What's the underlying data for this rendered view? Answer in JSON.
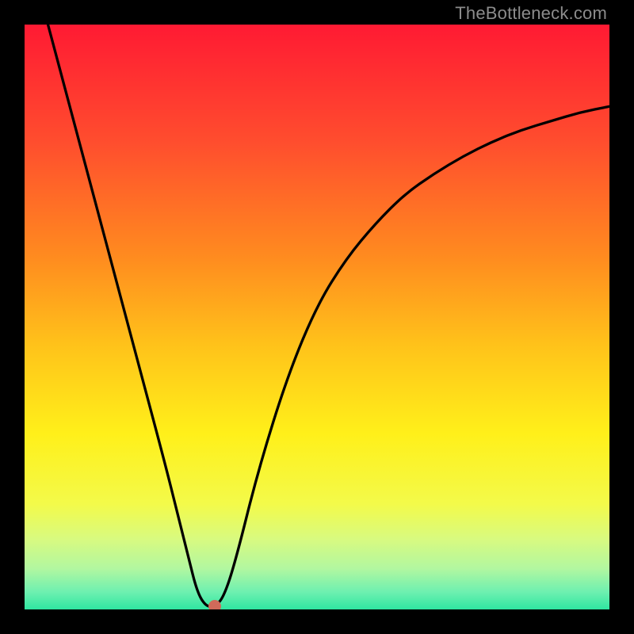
{
  "watermark": "TheBottleneck.com",
  "chart_data": {
    "type": "line",
    "title": "",
    "xlabel": "",
    "ylabel": "",
    "xlim": [
      0,
      100
    ],
    "ylim": [
      0,
      100
    ],
    "grid": false,
    "series": [
      {
        "name": "curve",
        "x": [
          4,
          8,
          12,
          16,
          20,
          24,
          26,
          28,
          29.5,
          31,
          32.5,
          34,
          36,
          40,
          45,
          50,
          55,
          60,
          65,
          70,
          75,
          80,
          85,
          90,
          95,
          100
        ],
        "y": [
          100,
          85,
          70,
          55,
          40,
          25,
          17,
          9,
          3,
          0.5,
          0.5,
          2,
          8,
          24,
          40,
          52,
          60,
          66,
          71,
          74.5,
          77.5,
          80,
          82,
          83.5,
          85,
          86
        ]
      }
    ],
    "marker": {
      "x": 32.5,
      "y": 0.5,
      "color": "#d06a5a"
    },
    "gradient_stops": [
      {
        "pos": 0.0,
        "color": "#ff1a33"
      },
      {
        "pos": 0.2,
        "color": "#ff4d2e"
      },
      {
        "pos": 0.4,
        "color": "#ff8c1f"
      },
      {
        "pos": 0.55,
        "color": "#ffc31a"
      },
      {
        "pos": 0.7,
        "color": "#fff01a"
      },
      {
        "pos": 0.82,
        "color": "#f3fa4a"
      },
      {
        "pos": 0.88,
        "color": "#d8fa80"
      },
      {
        "pos": 0.93,
        "color": "#b2f7a0"
      },
      {
        "pos": 0.97,
        "color": "#6ef0b0"
      },
      {
        "pos": 1.0,
        "color": "#2fe6a1"
      }
    ]
  }
}
